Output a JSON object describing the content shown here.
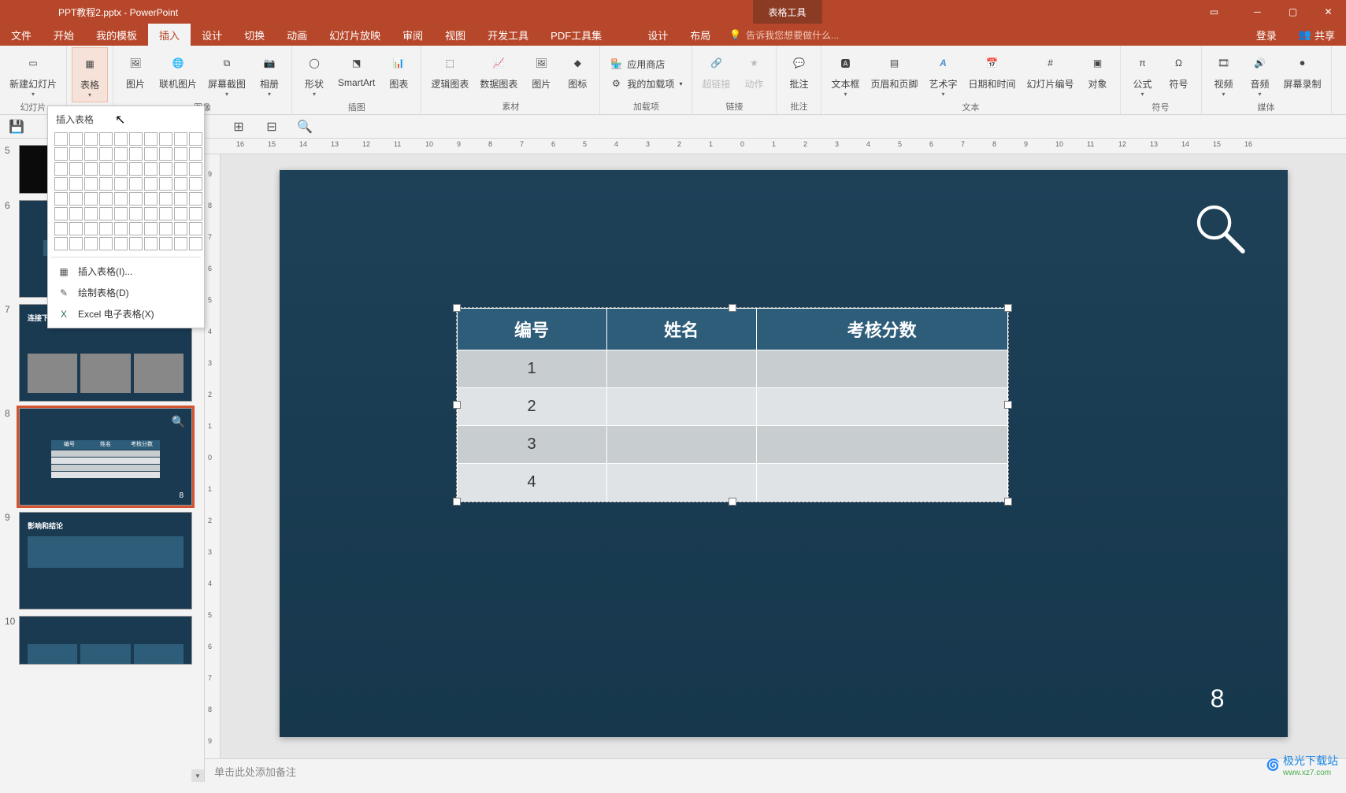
{
  "title_bar": {
    "filename": "PPT教程2.pptx - PowerPoint",
    "contextual_tab": "表格工具"
  },
  "tabs": {
    "file": "文件",
    "home": "开始",
    "mytpl": "我的模板",
    "insert": "插入",
    "design": "设计",
    "trans": "切换",
    "anim": "动画",
    "slideshow": "幻灯片放映",
    "review": "审阅",
    "view": "视图",
    "dev": "开发工具",
    "pdf": "PDF工具集",
    "tdesign": "设计",
    "tlayout": "布局",
    "tellme": "告诉我您想要做什么...",
    "login": "登录",
    "share": "共享"
  },
  "ribbon": {
    "slides": {
      "new_slide": "新建幻灯片",
      "group": "幻灯片"
    },
    "tables": {
      "table": "表格"
    },
    "images": {
      "picture": "图片",
      "online_pic": "联机图片",
      "screenshot": "屏幕截图",
      "album": "相册",
      "group": "图像"
    },
    "illus": {
      "shapes": "形状",
      "smartart": "SmartArt",
      "chart": "图表",
      "group": "插图"
    },
    "charts_ext": {
      "logic": "逻辑图表",
      "data": "数据图表",
      "pic": "图片",
      "icon": "图标",
      "group": "素材"
    },
    "addins": {
      "store": "应用商店",
      "myaddins": "我的加载项",
      "group": "加载项"
    },
    "links": {
      "hyperlink": "超链接",
      "action": "动作",
      "group": "链接"
    },
    "comments": {
      "comment": "批注",
      "group": "批注"
    },
    "text": {
      "textbox": "文本框",
      "headerfooter": "页眉和页脚",
      "wordart": "艺术字",
      "datetime": "日期和时间",
      "slidenum": "幻灯片编号",
      "object": "对象",
      "group": "文本"
    },
    "symbols": {
      "equation": "公式",
      "symbol": "符号",
      "group": "符号"
    },
    "media": {
      "video": "视频",
      "audio": "音频",
      "screenrec": "屏幕录制",
      "group": "媒体"
    }
  },
  "table_dropdown": {
    "title": "插入表格",
    "insert_table": "插入表格(I)...",
    "draw_table": "绘制表格(D)",
    "excel_sheet": "Excel 电子表格(X)"
  },
  "thumbnails": {
    "n5": "5",
    "n6": "6",
    "n7": "7",
    "n8": "8",
    "n9": "9",
    "n10": "10",
    "s7_title": "连接下面的短效果的标题",
    "s9_title": "影响和结论"
  },
  "slide": {
    "table_headers": [
      "编号",
      "姓名",
      "考核分数"
    ],
    "table_rows": [
      "1",
      "2",
      "3",
      "4"
    ],
    "slide_number": "8"
  },
  "mini_headers": [
    "编号",
    "姓名",
    "考核分数"
  ],
  "notes": {
    "placeholder": "单击此处添加备注"
  },
  "watermark": {
    "brand": "极光下载站",
    "url": "www.xz7.com"
  }
}
